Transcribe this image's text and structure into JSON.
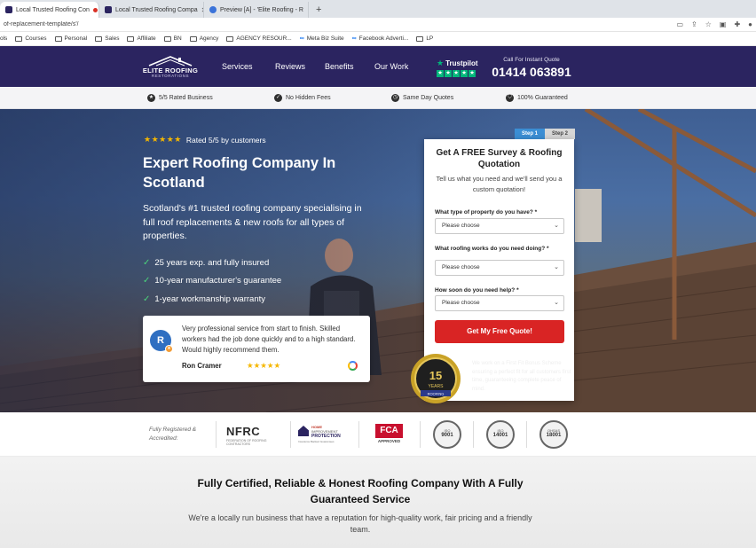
{
  "browser": {
    "tabs": [
      {
        "title": "Local Trusted Roofing Con",
        "active": true
      },
      {
        "title": "Local Trusted Roofing Compa",
        "active": false
      },
      {
        "title": "Preview [A] - 'Elite Roofing - R",
        "active": false
      }
    ],
    "new_tab": "+",
    "url": "of-replacement-template/s'/",
    "bookmarks": [
      "ols",
      "Courses",
      "Personal",
      "Sales",
      "Affiliate",
      "BN",
      "Agency",
      "AGENCY RESOUR...",
      "Meta Biz Suite",
      "Facebook Adverti...",
      "LP"
    ]
  },
  "header": {
    "logo_name": "ELITE ROOFING",
    "logo_sub": "RESTORATIONS",
    "nav": [
      "Services",
      "Reviews",
      "Benefits",
      "Our Work"
    ],
    "trustpilot": "Trustpilot",
    "call_label": "Call For Instant Quote",
    "phone": "01414 063891"
  },
  "trust_strip": [
    {
      "icon": "star-icon",
      "label": "5/5 Rated Business"
    },
    {
      "icon": "check-icon",
      "label": "No Hidden Fees"
    },
    {
      "icon": "clock-icon",
      "label": "Same Day Quotes"
    },
    {
      "icon": "shield-icon",
      "label": "100% Guaranteed"
    }
  ],
  "hero": {
    "rating_stars": "★★★★★",
    "rating_text": "Rated 5/5 by customers",
    "title": "Expert Roofing Company In Scotland",
    "subtitle": "Scotland's #1 trusted roofing company specialising in full roof replacements & new roofs for all types of properties.",
    "checks": [
      "25 years exp. and fully insured",
      "10-year manufacturer's guarantee",
      "1-year workmanship warranty"
    ],
    "review": {
      "avatar": "R",
      "text": "Very professional service from start to finish. Skilled workers had the job done quickly and to a high standard. Would highly recommend them.",
      "name": "Ron Cramer",
      "stars": "★★★★★"
    }
  },
  "form": {
    "step1": "Step 1",
    "step2": "Step 2",
    "title": "Get A FREE Survey & Roofing Quotation",
    "intro": "Tell us what you need and we'll send you a custom quotation!",
    "fields": [
      {
        "label": "What type of property do you have? *",
        "value": "Please choose"
      },
      {
        "label": "What roofing works do you need doing? *",
        "value": "Please choose"
      },
      {
        "label": "How soon do you need help? *",
        "value": "Please choose"
      }
    ],
    "cta": "Get My Free Quote!",
    "badge_number": "15",
    "badge_word": "YEARS",
    "badge_sub": "ROOFING",
    "fit_text": "We work on a First Fit Bonus Scheme ensuring a perfect fit for all customers first time, guaranteeing complete peace of mind."
  },
  "accreditation": {
    "label": "Fully Registered & Accredited:",
    "nfrc": "NFRC",
    "nfrc_sub": "FEDERATION OF ROOFING CONTRACTORS",
    "hip_l1": "HOME",
    "hip_l2": "IMPROVEMENT",
    "hip_l3": "PROTECTION",
    "hip_l4": "Insurance Backed Guarantees",
    "fca": "FCA",
    "fca_sub": "APPROVED",
    "iso": [
      {
        "top": "ISO",
        "num": "9001"
      },
      {
        "top": "ISO",
        "num": "14001"
      },
      {
        "top": "OHSAS",
        "num": "18001"
      }
    ]
  },
  "bottom": {
    "title": "Fully Certified, Reliable & Honest Roofing Company With A Fully Guaranteed Service",
    "subtitle": "We're a locally run business that have a reputation for high-quality work, fair pricing and a friendly team."
  },
  "colors": {
    "brand": "#2b2460",
    "cta": "#d92424",
    "trustpilot": "#00b67a",
    "star": "#f5b700"
  }
}
